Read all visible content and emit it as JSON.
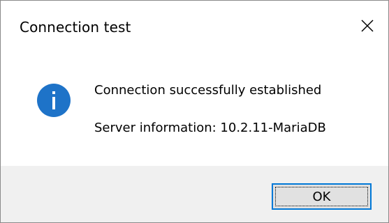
{
  "window": {
    "title": "Connection test",
    "close_icon": "close-icon"
  },
  "message": {
    "icon": "info-icon",
    "main_text": "Connection successfully established",
    "detail_text": "Server information: 10.2.11-MariaDB"
  },
  "buttons": {
    "ok_label": "OK"
  },
  "colors": {
    "icon_blue": "#1e73c8",
    "focus_border": "#0078d7",
    "button_face": "#e1e1e1",
    "footer_bg": "#f0f0f0"
  }
}
